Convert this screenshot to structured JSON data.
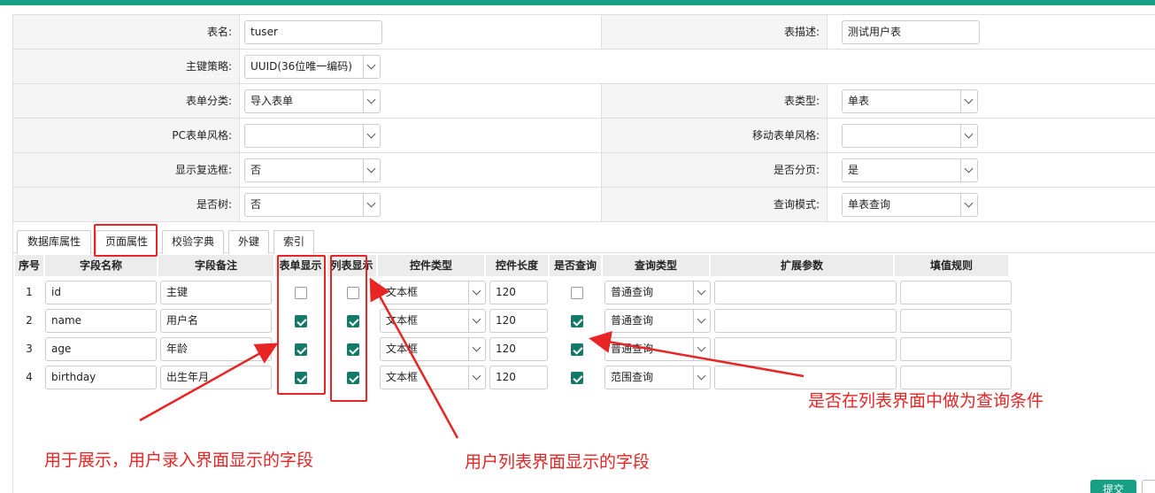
{
  "form": {
    "table_name": {
      "label": "表名:",
      "value": "tuser"
    },
    "table_desc": {
      "label": "表描述:",
      "value": "测试用户表"
    },
    "pk_strategy": {
      "label": "主键策略:",
      "value": "UUID(36位唯一编码)"
    },
    "form_category": {
      "label": "表单分类:",
      "value": "导入表单"
    },
    "table_type": {
      "label": "表类型:",
      "value": "单表"
    },
    "pc_style": {
      "label": "PC表单风格:",
      "value": ""
    },
    "mobile_style": {
      "label": "移动表单风格:",
      "value": ""
    },
    "show_checkbox": {
      "label": "显示复选框:",
      "value": "否"
    },
    "paginate": {
      "label": "是否分页:",
      "value": "是"
    },
    "is_tree": {
      "label": "是否树:",
      "value": "否"
    },
    "query_mode": {
      "label": "查询模式:",
      "value": "单表查询"
    }
  },
  "tabs": [
    "数据库属性",
    "页面属性",
    "校验字典",
    "外键",
    "索引"
  ],
  "active_tab": "页面属性",
  "grid": {
    "headers": [
      "序号",
      "字段名称",
      "字段备注",
      "表单显示",
      "列表显示",
      "控件类型",
      "控件长度",
      "是否查询",
      "查询类型",
      "扩展参数",
      "填值规则"
    ],
    "rows": [
      {
        "num": "1",
        "name": "id",
        "remark": "主键",
        "form_show": false,
        "list_show": false,
        "control": "文本框",
        "length": "120",
        "query": false,
        "query_type": "普通查询",
        "ext": "",
        "fill": ""
      },
      {
        "num": "2",
        "name": "name",
        "remark": "用户名",
        "form_show": true,
        "list_show": true,
        "control": "文本框",
        "length": "120",
        "query": true,
        "query_type": "普通查询",
        "ext": "",
        "fill": ""
      },
      {
        "num": "3",
        "name": "age",
        "remark": "年龄",
        "form_show": true,
        "list_show": true,
        "control": "文本框",
        "length": "120",
        "query": true,
        "query_type": "普通查询",
        "ext": "",
        "fill": ""
      },
      {
        "num": "4",
        "name": "birthday",
        "remark": "出生年月",
        "form_show": true,
        "list_show": true,
        "control": "文本框",
        "length": "120",
        "query": true,
        "query_type": "范围查询",
        "ext": "",
        "fill": ""
      }
    ]
  },
  "annotations": {
    "form_display_note": "用于展示，用户录入界面显示的字段",
    "list_display_note": "用户列表界面显示的字段",
    "query_note": "是否在列表界面中做为查询条件"
  },
  "buttons": {
    "submit": "提交"
  },
  "colors": {
    "accent": "#17a085",
    "annotation": "#e82424",
    "checkbox": "#137a68"
  }
}
